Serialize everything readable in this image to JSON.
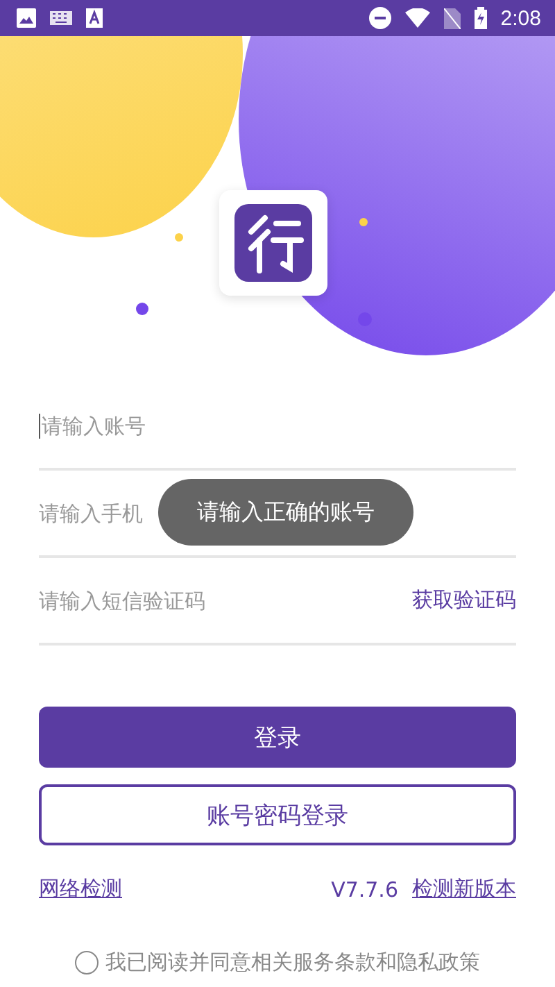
{
  "status_bar": {
    "time": "2:08"
  },
  "form": {
    "fields": [
      {
        "placeholder": "请输入账号",
        "focused": true
      },
      {
        "placeholder": "请输入手机",
        "focused": false
      },
      {
        "placeholder": "请输入短信验证码",
        "focused": false,
        "action": "获取验证码"
      }
    ]
  },
  "toast": "请输入正确的账号",
  "buttons": [
    {
      "label": "登录",
      "kind": "primary"
    },
    {
      "label": "账号密码登录",
      "kind": "outline"
    }
  ],
  "links": {
    "network_check": "网络检测",
    "version": "V7.7.6",
    "check_update": "检测新版本"
  },
  "agreement": {
    "text": "我已阅读并同意相关服务条款和隐私政策",
    "checked": false
  }
}
